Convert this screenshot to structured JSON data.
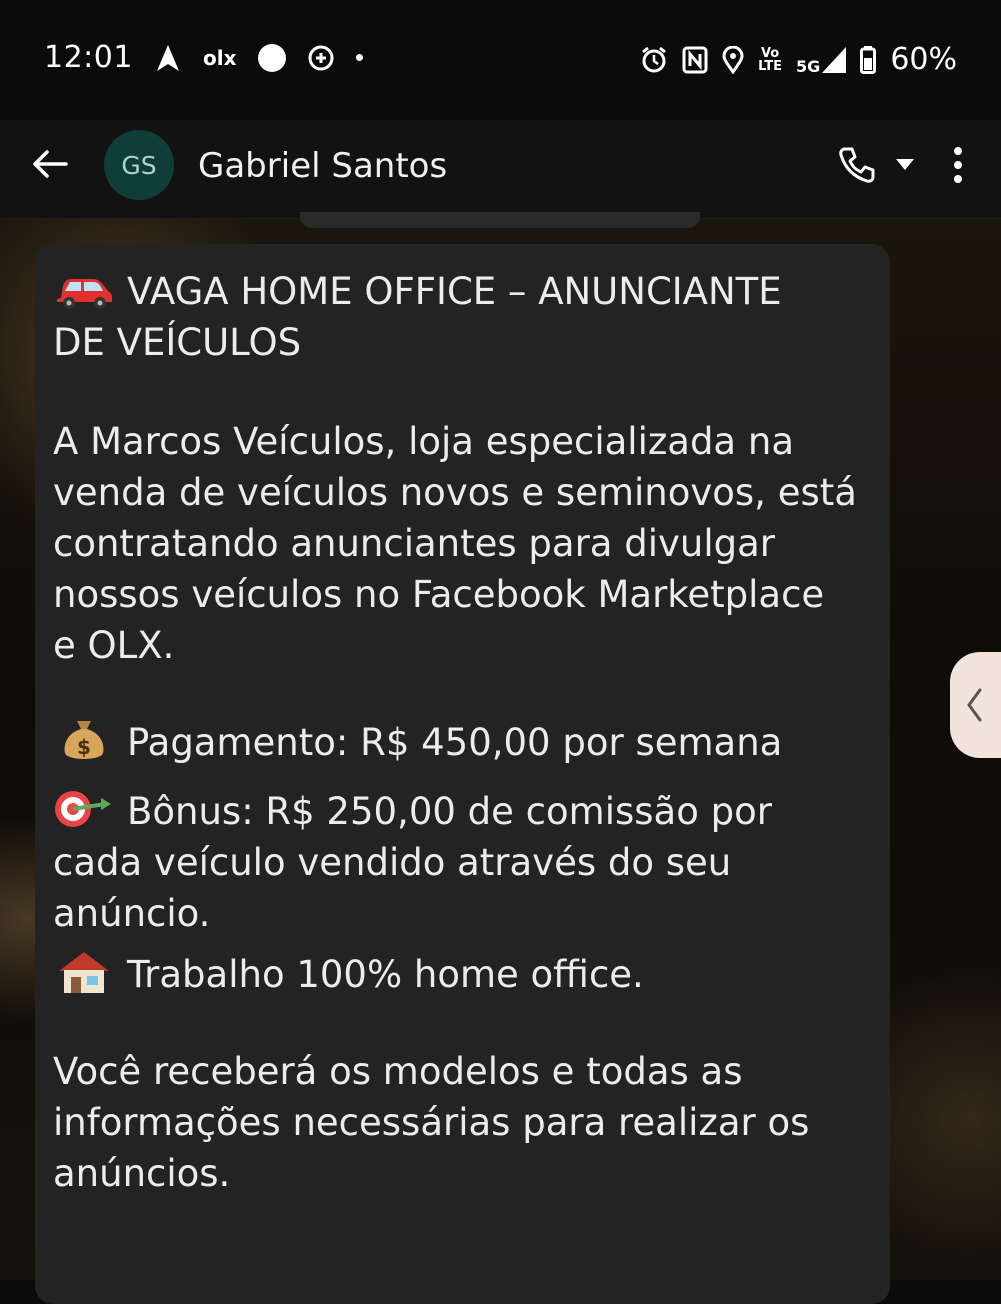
{
  "status_bar": {
    "time": "12:01",
    "olx_label": "olx",
    "battery": "60%",
    "network_top": "Vo",
    "network_bottom": "LTE",
    "network_5g": "5G",
    "icons": [
      "navigation-arrow-icon",
      "olx-icon",
      "circle-icon",
      "app-icon",
      "dot-icon",
      "alarm-icon",
      "nfc-icon",
      "location-icon",
      "volte-icon",
      "signal-icon",
      "battery-icon"
    ]
  },
  "header": {
    "avatar_initials": "GS",
    "contact_name": "Gabriel Santos",
    "icons": [
      "back-arrow-icon",
      "phone-icon",
      "caret-down-icon",
      "more-vert-icon"
    ]
  },
  "message": {
    "title_line1": "VAGA HOME OFFICE – ANUNCIANTE",
    "title_line2": "DE VEÍCULOS",
    "intro": [
      "A Marcos Veículos, loja especializada na",
      "venda de veículos novos e seminovos, está",
      "contratando anunciantes para divulgar",
      "nossos veículos no Facebook Marketplace",
      "e OLX."
    ],
    "payment": "Pagamento: R$ 450,00 por semana",
    "bonus_line1": "Bônus: R$ 250,00 de comissão por",
    "bonus_line2": "cada veículo vendido através do seu",
    "bonus_line3": "anúncio.",
    "home_office": "Trabalho 100% home office.",
    "closing": [
      "Você receberá os modelos e todas as",
      "informações necessárias para realizar os",
      "anúncios."
    ],
    "emojis": [
      "car-emoji",
      "money-bag-emoji",
      "target-emoji",
      "house-emoji"
    ]
  },
  "side_panel": {
    "icon": "chevron-left-icon"
  },
  "colors": {
    "bubble": "#232323",
    "avatar_bg": "#103c3a",
    "avatar_text": "#a9d4d0"
  }
}
